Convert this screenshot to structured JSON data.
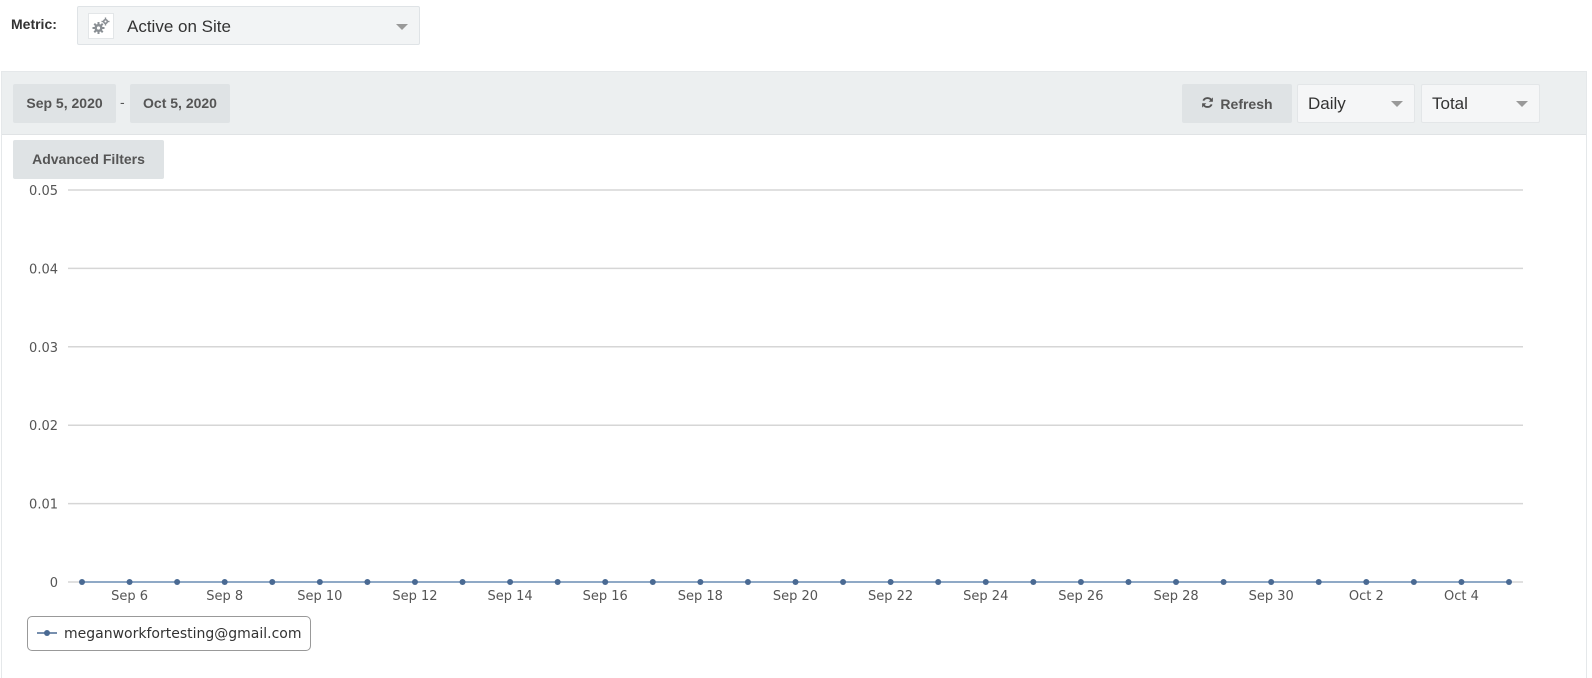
{
  "metric": {
    "label": "Metric:",
    "selected": "Active on Site",
    "icon": "gears-icon"
  },
  "toolbar": {
    "date_start": "Sep 5, 2020",
    "date_separator": "-",
    "date_end": "Oct 5, 2020",
    "refresh_label": "Refresh",
    "interval_selected": "Daily",
    "aggregation_selected": "Total"
  },
  "filters": {
    "advanced_label": "Advanced Filters"
  },
  "colors": {
    "series": "#4a6a93",
    "series_line": "#8fa9c6",
    "grid": "#d6d6d6"
  },
  "chart_data": {
    "type": "line",
    "title": "",
    "xlabel": "",
    "ylabel": "",
    "ylim": [
      0,
      0.05
    ],
    "y_ticks": [
      "0",
      "0.01",
      "0.02",
      "0.03",
      "0.04",
      "0.05"
    ],
    "y_tick_values": [
      0,
      0.01,
      0.02,
      0.03,
      0.04,
      0.05
    ],
    "grid": true,
    "legend_position": "bottom-left",
    "x": [
      "Sep 5",
      "Sep 6",
      "Sep 7",
      "Sep 8",
      "Sep 9",
      "Sep 10",
      "Sep 11",
      "Sep 12",
      "Sep 13",
      "Sep 14",
      "Sep 15",
      "Sep 16",
      "Sep 17",
      "Sep 18",
      "Sep 19",
      "Sep 20",
      "Sep 21",
      "Sep 22",
      "Sep 23",
      "Sep 24",
      "Sep 25",
      "Sep 26",
      "Sep 27",
      "Sep 28",
      "Sep 29",
      "Sep 30",
      "Oct 1",
      "Oct 2",
      "Oct 3",
      "Oct 4",
      "Oct 5"
    ],
    "x_tick_labels": [
      "Sep 6",
      "Sep 8",
      "Sep 10",
      "Sep 12",
      "Sep 14",
      "Sep 16",
      "Sep 18",
      "Sep 20",
      "Sep 22",
      "Sep 24",
      "Sep 26",
      "Sep 28",
      "Sep 30",
      "Oct 2",
      "Oct 4"
    ],
    "series": [
      {
        "name": "meganworkfortesting@gmail.com",
        "values": [
          0,
          0,
          0,
          0,
          0,
          0,
          0,
          0,
          0,
          0,
          0,
          0,
          0,
          0,
          0,
          0,
          0,
          0,
          0,
          0,
          0,
          0,
          0,
          0,
          0,
          0,
          0,
          0,
          0,
          0,
          0
        ]
      }
    ]
  }
}
